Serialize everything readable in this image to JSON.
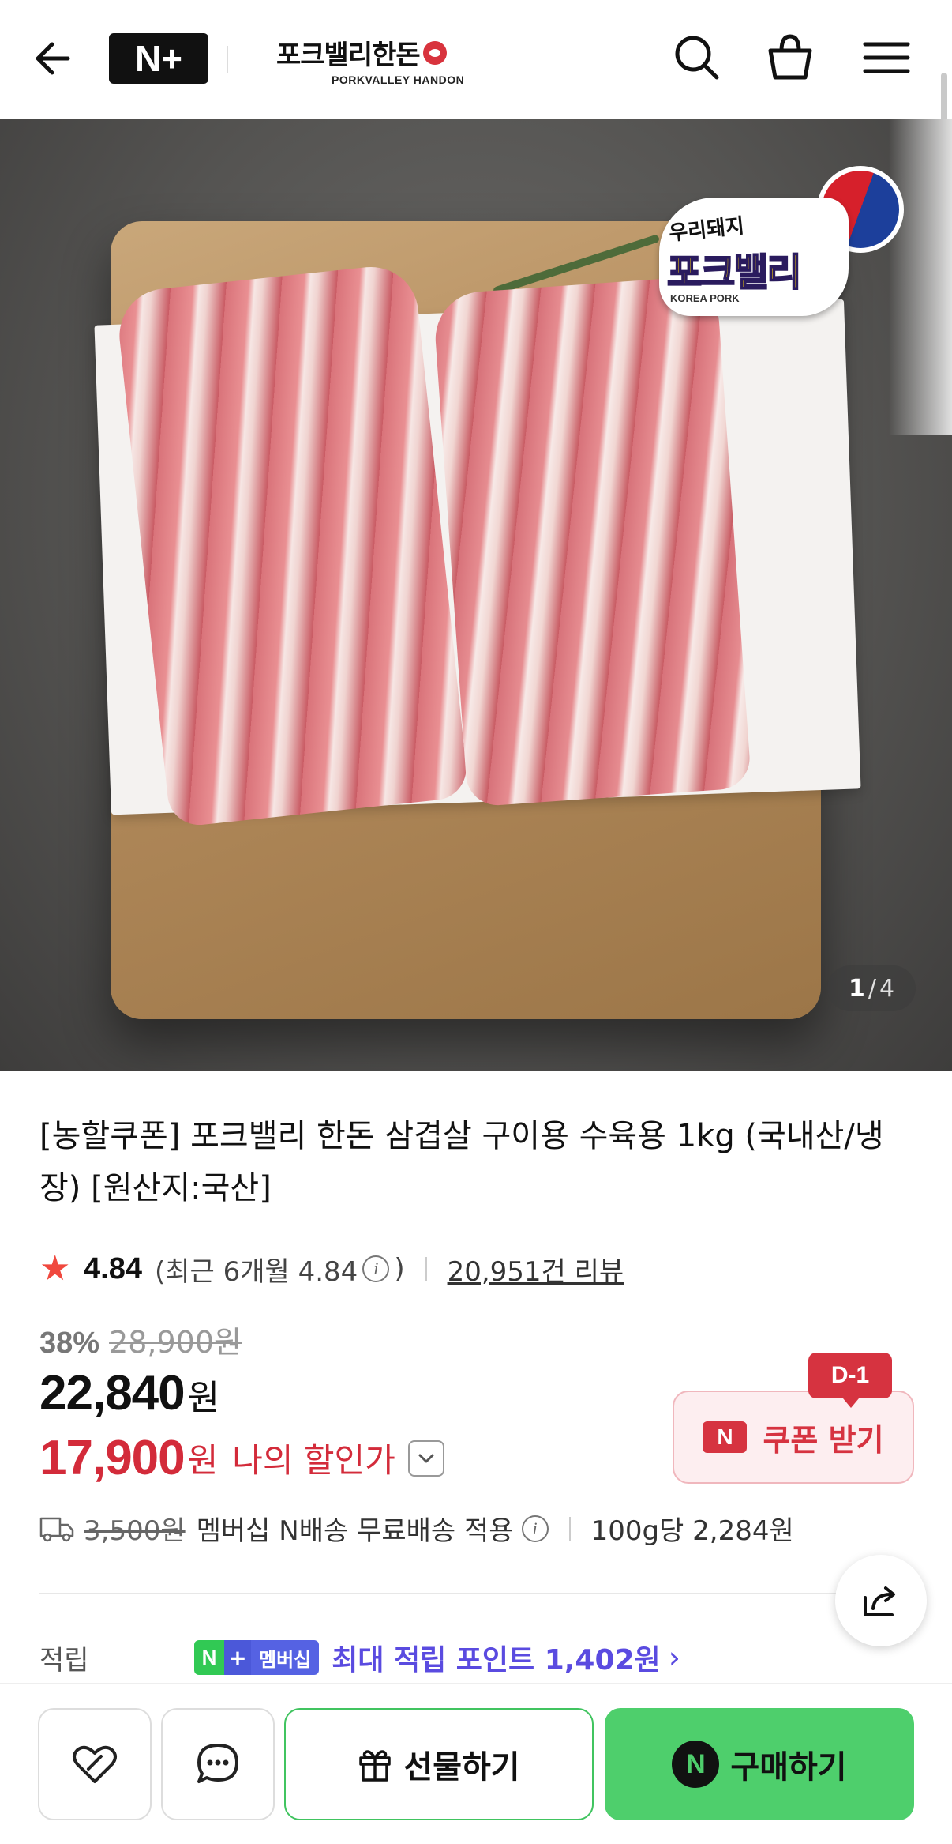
{
  "header": {
    "partner_badge": "N+",
    "brand_name": "포크밸리한돈",
    "brand_sub": "PORKVALLEY HANDON",
    "icons": [
      "back-arrow-icon",
      "search-icon",
      "shopping-bag-icon",
      "menu-icon"
    ]
  },
  "hero": {
    "sticker_top": "우리돼지",
    "sticker_main": "포크밸리",
    "sticker_sub": "KOREA PORK",
    "pager_current": "1",
    "pager_sep": "/",
    "pager_total": "4"
  },
  "product": {
    "title": "[농할쿠폰] 포크밸리 한돈 삼겹살 구이용 수육용 1kg (국내산/냉장) [원산지:국산]",
    "rating": "4.84",
    "rating_recent": "(최근 6개월 4.84",
    "rating_recent_close": ")",
    "info_glyph": "i",
    "review_count": "20,951건 리뷰",
    "discount_rate": "38%",
    "original_price": "28,900원",
    "price": "22,840",
    "price_unit": "원",
    "my_price": "17,900",
    "my_price_unit": "원",
    "my_price_label": "나의 할인가",
    "coupon_dday": "D-1",
    "coupon_icon": "N",
    "coupon_label": "쿠폰 받기",
    "shipping_original": "3,500원",
    "shipping_text": "멤버십 N배송 무료배송 적용",
    "unit_price": "100g당 2,284원",
    "point_label": "적립",
    "member_badge_n": "N",
    "member_badge_plus": "+",
    "member_badge_text": "멤버십",
    "point_text": "최대 적립 포인트 1,402원",
    "point_chevron": "›"
  },
  "bottom_bar": {
    "gift_label": "선물하기",
    "buy_icon": "N",
    "buy_label": "구매하기"
  },
  "colors": {
    "discount_red": "#d32b3a",
    "buy_green": "#4ecf6c",
    "point_purple": "#5a4be0"
  }
}
